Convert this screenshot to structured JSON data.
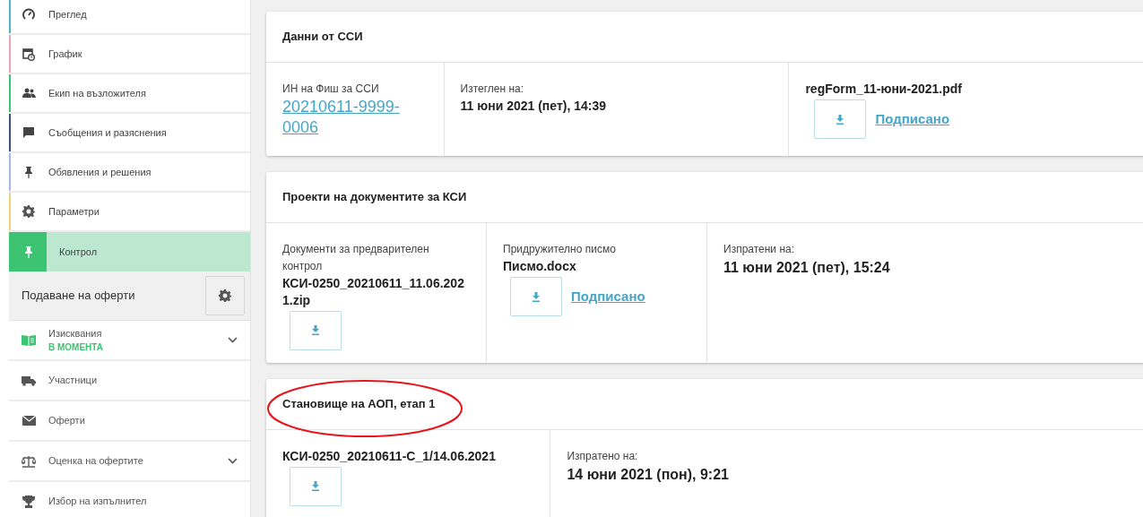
{
  "sidebar": {
    "items": [
      {
        "label": "Преглед",
        "color": "#4fb3c8",
        "selected": false
      },
      {
        "label": "График",
        "color": "#f0a3b8",
        "selected": false
      },
      {
        "label": "Екип на възложителя",
        "color": "#3cc472",
        "selected": false
      },
      {
        "label": "Съобщения и разяснения",
        "color": "#3d4f7d",
        "selected": false
      },
      {
        "label": "Обявления и решения",
        "color": "#a9b6e3",
        "selected": false
      },
      {
        "label": "Параметри",
        "color": "#f2cf7a",
        "selected": false
      },
      {
        "label": "Контрол",
        "color": "#3cc472",
        "selected": true
      }
    ],
    "section": {
      "title": "Подаване на оферти",
      "items": [
        {
          "label": "Изисквания",
          "status": "В МОМЕНТА",
          "expandable": true
        },
        {
          "label": "Участници",
          "expandable": false
        },
        {
          "label": "Оферти",
          "expandable": false
        },
        {
          "label": "Оценка на офертите",
          "expandable": true
        },
        {
          "label": "Избор на изпълнител",
          "expandable": false
        }
      ]
    }
  },
  "cards": [
    {
      "title": "Данни от ССИ",
      "circled": false,
      "cells": [
        {
          "kind": "id",
          "label": "ИН на Фиш за ССИ",
          "value": "20210611-9999-0006"
        },
        {
          "kind": "date",
          "label": "Изтеглен на:",
          "value": "11 юни 2021 (пет), 14:39"
        },
        {
          "kind": "file",
          "filename": "regForm_11-юни-2021.pdf",
          "signed": "Подписано"
        }
      ]
    },
    {
      "title": "Проекти на документите за КСИ",
      "circled": false,
      "cells": [
        {
          "kind": "file",
          "label": "Документи за предварителен контрол",
          "filename": "КСИ-0250_20210611_11.06.2021.zip"
        },
        {
          "kind": "file",
          "label": "Придружително писмо",
          "filename": "Писмо.docx",
          "signed": "Подписано"
        },
        {
          "kind": "date",
          "label": "Изпратени на:",
          "value": "11 юни 2021 (пет), 15:24"
        }
      ]
    },
    {
      "title": "Становище на АОП, етап 1",
      "circled": true,
      "cells": [
        {
          "kind": "file",
          "filename": "КСИ-0250_20210611-С_1/14.06.2021"
        },
        {
          "kind": "date",
          "label": "Изпратено на:",
          "value": "14 юни 2021 (пон), 9:21"
        }
      ]
    }
  ]
}
